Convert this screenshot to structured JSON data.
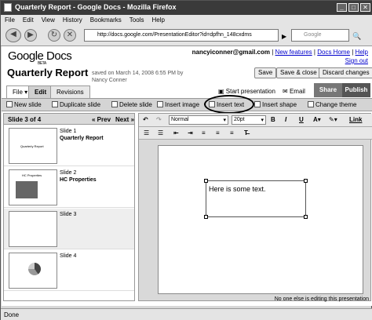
{
  "window": {
    "title": "Quarterly Report - Google Docs - Mozilla Firefox"
  },
  "menu": [
    "File",
    "Edit",
    "View",
    "History",
    "Bookmarks",
    "Tools",
    "Help"
  ],
  "nav": {
    "url": "http://docs.google.com/PresentationEditor?id=dpfhn_148cxdms",
    "search_placeholder": "Google"
  },
  "header": {
    "logo": "Google Docs",
    "logo_sub": "BETA",
    "email": "nancyiconner@gmail.com",
    "sep1": " | ",
    "new_features": "New features",
    "sep2": " | ",
    "docs_home": "Docs Home",
    "sep3": " | ",
    "help": "Help",
    "sign_out": "Sign out",
    "doc_title": "Quarterly Report",
    "saved_text": "saved on March 14, 2008 6:55 PM by Nancy Conner",
    "save": "Save",
    "save_close": "Save & close",
    "discard": "Discard changes"
  },
  "tabs": {
    "file": "File",
    "edit": "Edit",
    "revisions": "Revisions",
    "start": "Start presentation",
    "email": "Email",
    "share": "Share",
    "publish": "Publish"
  },
  "toolbar": {
    "new_slide": "New slide",
    "duplicate": "Duplicate slide",
    "delete": "Delete slide",
    "insert_image": "Insert image",
    "insert_text": "Insert text",
    "insert_shape": "Insert shape",
    "change_theme": "Change theme"
  },
  "slides_panel": {
    "heading": "Slide 3 of 4",
    "prev": "« Prev",
    "next": "Next »",
    "slides": [
      {
        "num": "Slide 1",
        "title": "Quarterly Report",
        "thumb_text": "Quarterly Report"
      },
      {
        "num": "Slide 2",
        "title": "HC Properties",
        "thumb_text": "HC Properties"
      },
      {
        "num": "Slide 3",
        "title": "",
        "thumb_text": ""
      },
      {
        "num": "Slide 4",
        "title": "",
        "thumb_text": ""
      }
    ]
  },
  "format": {
    "style": "Normal",
    "size": "20pt",
    "bold": "B",
    "italic": "I",
    "underline": "U",
    "link": "Link"
  },
  "canvas": {
    "text": "Here is some text."
  },
  "status": {
    "collab": "No one else is editing this presentation",
    "browser": "Done"
  }
}
